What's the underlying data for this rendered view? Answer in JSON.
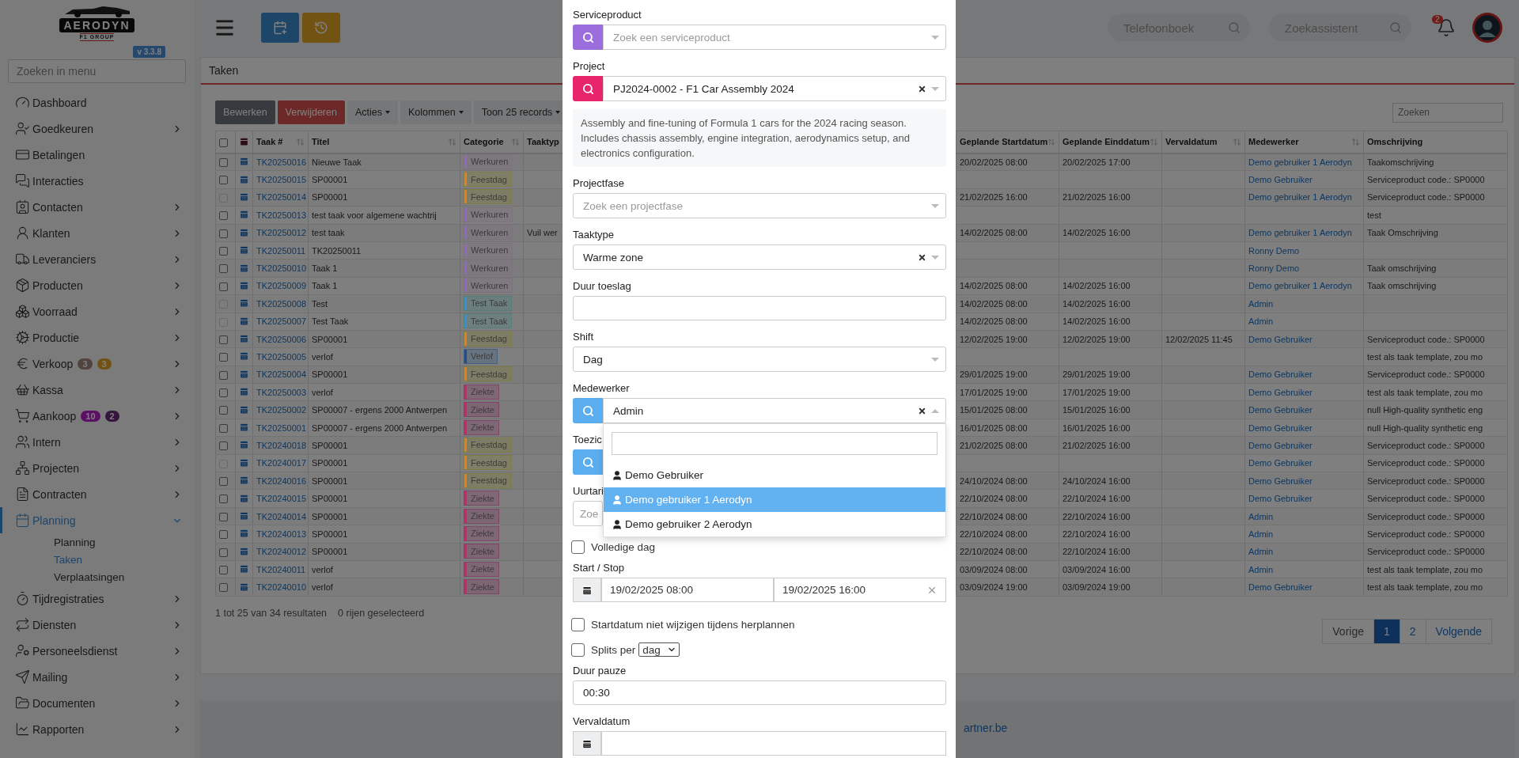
{
  "sidebar": {
    "logo": {
      "wordmark": "AERODYN",
      "subtitle": "F1 GROUP"
    },
    "version": "v 3.3.8",
    "search": {
      "placeholder": "Zoeken in menu"
    },
    "items": [
      {
        "label": "Dashboard",
        "kind": "link",
        "selected": false
      },
      {
        "label": "Goedkeuren",
        "kind": "group",
        "expanded": false,
        "selected": false
      },
      {
        "label": "Betalingen",
        "kind": "link",
        "selected": false
      },
      {
        "label": "Interacties",
        "kind": "link",
        "selected": false
      },
      {
        "label": "Contacten",
        "kind": "group",
        "expanded": false,
        "selected": false
      },
      {
        "label": "Klanten",
        "kind": "group",
        "expanded": false,
        "selected": false
      },
      {
        "label": "Leveranciers",
        "kind": "group",
        "expanded": false,
        "selected": false
      },
      {
        "label": "Producten",
        "kind": "group",
        "expanded": false,
        "selected": false
      },
      {
        "label": "Voorraad",
        "kind": "group",
        "expanded": false,
        "selected": false
      },
      {
        "label": "Productie",
        "kind": "group",
        "expanded": false,
        "selected": false
      },
      {
        "label": "Verkoop",
        "kind": "group",
        "expanded": false,
        "selected": false,
        "badges": [
          {
            "text": "3",
            "color": "#50443f"
          },
          {
            "text": "3",
            "color": "#705213"
          }
        ]
      },
      {
        "label": "Kassa",
        "kind": "group",
        "expanded": false,
        "selected": false
      },
      {
        "label": "Aankoop",
        "kind": "group",
        "expanded": false,
        "selected": false,
        "badges": [
          {
            "text": "10",
            "color": "#5b1064"
          },
          {
            "text": "2",
            "color": "#35153c"
          }
        ]
      },
      {
        "label": "Intern",
        "kind": "group",
        "expanded": false,
        "selected": false
      },
      {
        "label": "Projecten",
        "kind": "group",
        "expanded": false,
        "selected": false
      },
      {
        "label": "Contracten",
        "kind": "group",
        "expanded": false,
        "selected": false
      },
      {
        "label": "Planning",
        "kind": "group",
        "expanded": true,
        "selected": true,
        "children": [
          {
            "label": "Planning",
            "selected": false
          },
          {
            "label": "Taken",
            "selected": true
          },
          {
            "label": "Verplaatsingen",
            "selected": false
          }
        ]
      },
      {
        "label": "Tijdregistraties",
        "kind": "group",
        "expanded": false,
        "selected": false
      },
      {
        "label": "Diensten",
        "kind": "group",
        "expanded": false,
        "selected": false
      },
      {
        "label": "Personeelsdienst",
        "kind": "group",
        "expanded": false,
        "selected": false
      },
      {
        "label": "Mailing",
        "kind": "group",
        "expanded": false,
        "selected": false
      },
      {
        "label": "Documenten",
        "kind": "group",
        "expanded": false,
        "selected": false
      },
      {
        "label": "Rapporten",
        "kind": "group",
        "expanded": false,
        "selected": false
      }
    ]
  },
  "topbar": {
    "phonebook": {
      "placeholder": "Telefoonboek"
    },
    "assistant": {
      "placeholder": "Zoekassistent"
    },
    "notifications": {
      "count": "2"
    }
  },
  "panel": {
    "title": "Taken",
    "toolbar": [
      {
        "label": "Bewerken",
        "kind": "secondary"
      },
      {
        "label": "Verwijderen",
        "kind": "danger"
      },
      {
        "label": "Acties",
        "kind": "dropdown"
      },
      {
        "label": "Kolommen",
        "kind": "dropdown"
      },
      {
        "label": "Toon 25 records",
        "kind": "dropdown"
      }
    ],
    "search": {
      "placeholder": "Zoeken"
    },
    "table": {
      "select_all_checked": false,
      "columns_left": [
        {
          "label": "Taak #",
          "sortable": true
        },
        {
          "label": "Titel",
          "sortable": true
        },
        {
          "label": "Categorie",
          "sortable": true
        },
        {
          "label": "Taaktyp",
          "sortable": false
        }
      ],
      "columns_right": [
        {
          "label": "Geplande Startdatum",
          "sortable": true
        },
        {
          "label": "Geplande Einddatum",
          "sortable": true
        },
        {
          "label": "Vervaldatum",
          "sortable": true
        },
        {
          "label": "Medewerker",
          "sortable": true
        },
        {
          "label": "Omschrijving",
          "sortable": false
        }
      ],
      "rows": [
        {
          "task_no": "TK20250016",
          "title": "Nieuwe Taak",
          "category": {
            "label": "Werkuren",
            "color": "#8e6bbf"
          },
          "start": "20/02/2025 08:00",
          "end": "20/02/2025 17:00",
          "employee": "Demo gebruiker 1 Aerodyn",
          "description": "Taakomschrijving",
          "checked": false,
          "disabled": false
        },
        {
          "task_no": "TK20250015",
          "title": "SP00001",
          "category": {
            "label": "Feestdag",
            "color": "#e67e22"
          },
          "employee": "Demo Gebruiker",
          "description": "Serviceproduct code.: SP0000",
          "checked": false,
          "disabled": false
        },
        {
          "task_no": "TK20250014",
          "title": "SP00001",
          "category": {
            "label": "Feestdag",
            "color": "#e67e22"
          },
          "start": "21/02/2025 16:00",
          "end": "21/02/2025 16:00",
          "employee": "Demo gebruiker 1 Aerodyn",
          "description": "Serviceproduct code.: SP0000",
          "checked": false,
          "disabled": true
        },
        {
          "task_no": "TK20250013",
          "title": "test taak voor algemene wachtrij",
          "category": {
            "label": "Werkuren",
            "color": "#8e6bbf"
          },
          "description": "test",
          "checked": false,
          "disabled": false
        },
        {
          "task_no": "TK20250012",
          "title": "test taak",
          "category": {
            "label": "Werkuren",
            "color": "#8e6bbf"
          },
          "type": "Vuil wer",
          "start": "14/02/2025 08:00",
          "end": "14/02/2025 16:00",
          "employee": "Demo gebruiker 1 Aerodyn",
          "description": "Taak Omschrijving",
          "checked": false,
          "disabled": false
        },
        {
          "task_no": "TK20250011",
          "title": "TK20250011",
          "category": {
            "label": "Werkuren",
            "color": "#8e6bbf"
          },
          "employee": "Ronny Demo",
          "checked": false,
          "disabled": false
        },
        {
          "task_no": "TK20250010",
          "title": "Taak 1",
          "category": {
            "label": "Werkuren",
            "color": "#8e6bbf"
          },
          "employee": "Ronny Demo",
          "description": "Taak omschrijving",
          "checked": false,
          "disabled": false
        },
        {
          "task_no": "TK20250009",
          "title": "Taak 1",
          "category": {
            "label": "Werkuren",
            "color": "#8e6bbf"
          },
          "start": "14/02/2025 08:00",
          "end": "14/02/2025 16:00",
          "employee": "Demo gebruiker 1 Aerodyn",
          "description": "Taak omschrijving",
          "checked": false,
          "disabled": false
        },
        {
          "task_no": "TK20250008",
          "title": "Test",
          "category": {
            "label": "Test Taak",
            "color": "#3b8ed6"
          },
          "start": "14/02/2025 08:00",
          "end": "14/02/2025 16:00",
          "employee": "Admin",
          "checked": false,
          "disabled": true
        },
        {
          "task_no": "TK20250007",
          "title": "Test Taak",
          "category": {
            "label": "Test Taak",
            "color": "#3b8ed6"
          },
          "start": "14/02/2025 08:00",
          "end": "14/02/2025 16:00",
          "employee": "Admin",
          "checked": false,
          "disabled": true
        },
        {
          "task_no": "TK20250006",
          "title": "SP00001",
          "category": {
            "label": "Feestdag",
            "color": "#e67e22"
          },
          "start": "12/02/2025 19:00",
          "end": "12/02/2025 19:00",
          "due": "12/02/2025 11:45",
          "employee": "Demo Gebruiker",
          "description": "Serviceproduct code.: SP0000",
          "checked": false,
          "disabled": false
        },
        {
          "task_no": "TK20250005",
          "title": "verlof",
          "category": {
            "label": "Verlof",
            "color": "#1f4e8c"
          },
          "description": "test als taak template, zou mo",
          "checked": false,
          "disabled": false
        },
        {
          "task_no": "TK20250004",
          "title": "SP00001",
          "category": {
            "label": "Feestdag",
            "color": "#e67e22"
          },
          "start": "29/01/2025 19:00",
          "end": "29/01/2025 19:00",
          "employee": "Demo Gebruiker",
          "description": "Serviceproduct code.: SP0000",
          "checked": false,
          "disabled": false
        },
        {
          "task_no": "TK20250003",
          "title": "verlof",
          "category": {
            "label": "Ziekte",
            "color": "#d6245c"
          },
          "start": "17/01/2025 19:00",
          "end": "17/01/2025 19:00",
          "employee": "Demo Gebruiker",
          "description": "test als taak template, zou mo",
          "checked": false,
          "disabled": false
        },
        {
          "task_no": "TK20250002",
          "title": "SP00007 - ergens 2000 Antwerpen",
          "category": {
            "label": "Ziekte",
            "color": "#d6245c"
          },
          "start": "15/01/2025 08:00",
          "end": "15/01/2025 16:00",
          "employee": "Demo Gebruiker",
          "description": "null High-quality synthetic eng",
          "checked": false,
          "disabled": false
        },
        {
          "task_no": "TK20250001",
          "title": "SP00007 - ergens 2000 Antwerpen",
          "category": {
            "label": "Ziekte",
            "color": "#d6245c"
          },
          "start": "16/01/2025 08:00",
          "end": "16/01/2025 16:00",
          "employee": "Demo Gebruiker",
          "description": "null High-quality synthetic eng",
          "checked": false,
          "disabled": false
        },
        {
          "task_no": "TK20240018",
          "title": "SP00001",
          "category": {
            "label": "Feestdag",
            "color": "#e67e22"
          },
          "start": "21/02/2025 08:00",
          "end": "21/02/2025 16:00",
          "employee": "Demo Gebruiker",
          "description": "Serviceproduct code.: SP0000",
          "checked": false,
          "disabled": false
        },
        {
          "task_no": "TK20240017",
          "title": "SP00001",
          "category": {
            "label": "Feestdag",
            "color": "#e67e22"
          },
          "employee": "Demo Gebruiker",
          "description": "Serviceproduct code.: SP0000",
          "checked": false,
          "disabled": true
        },
        {
          "task_no": "TK20240016",
          "title": "SP00001",
          "category": {
            "label": "Feestdag",
            "color": "#e67e22"
          },
          "start": "24/10/2024 08:00",
          "end": "24/10/2024 16:00",
          "employee": "Demo Gebruiker",
          "description": "Serviceproduct code.: SP0000",
          "checked": false,
          "disabled": false
        },
        {
          "task_no": "TK20240015",
          "title": "SP00001",
          "category": {
            "label": "Ziekte",
            "color": "#d6245c"
          },
          "start": "22/10/2024 08:00",
          "end": "22/10/2024 16:00",
          "employee": "Demo Gebruiker",
          "description": "Serviceproduct code.: SP0000",
          "checked": false,
          "disabled": false
        },
        {
          "task_no": "TK20240014",
          "title": "SP00001",
          "category": {
            "label": "Ziekte",
            "color": "#d6245c"
          },
          "start": "22/10/2024 08:00",
          "end": "22/10/2024 16:00",
          "employee": "Admin",
          "description": "Serviceproduct code.: SP0000",
          "checked": false,
          "disabled": false
        },
        {
          "task_no": "TK20240013",
          "title": "SP00001",
          "category": {
            "label": "Ziekte",
            "color": "#d6245c"
          },
          "start": "22/10/2024 08:00",
          "end": "22/10/2024 16:00",
          "employee": "Admin",
          "description": "Serviceproduct code.: SP0000",
          "checked": false,
          "disabled": false
        },
        {
          "task_no": "TK20240012",
          "title": "SP00001",
          "category": {
            "label": "Ziekte",
            "color": "#d6245c"
          },
          "start": "22/10/2024 08:00",
          "end": "22/10/2024 16:00",
          "employee": "Admin",
          "description": "Serviceproduct code.: SP0000",
          "checked": false,
          "disabled": false
        },
        {
          "task_no": "TK20240011",
          "title": "verlof",
          "category": {
            "label": "Ziekte",
            "color": "#d6245c"
          },
          "start": "03/09/2024 08:00",
          "end": "03/09/2024 16:00",
          "employee": "Admin",
          "description": "test als taak template, zou mo",
          "checked": false,
          "disabled": false
        },
        {
          "task_no": "TK20240010",
          "title": "verlof",
          "category": {
            "label": "Ziekte",
            "color": "#d6245c"
          },
          "start": "03/09/2024 19:00",
          "end": "03/09/2024 19:00",
          "employee": "Demo Gebruiker",
          "description": "test als taak template, zou mo",
          "checked": false,
          "disabled": false
        }
      ]
    },
    "summary": "1 tot 25 van 34 resultaten",
    "selection": "0 rijen geselecteerd",
    "pagination": [
      {
        "label": "Vorige",
        "selected": false
      },
      {
        "label": "1",
        "selected": true
      },
      {
        "label": "2",
        "selected": false
      },
      {
        "label": "Volgende",
        "selected": false
      }
    ]
  },
  "footer": {
    "link": "artner.be"
  },
  "modal": {
    "fields": [
      {
        "kind": "search-select",
        "label": "Serviceproduct",
        "color": "#9c6ddc",
        "placeholder": "Zoek een serviceproduct"
      },
      {
        "kind": "search-select",
        "label": "Project",
        "color": "#e8246a",
        "value": "PJ2024-0002 - F1 Car Assembly 2024",
        "clearable": true
      },
      {
        "kind": "note",
        "text": "Assembly and fine-tuning of Formula 1 cars for the 2024 racing season. Includes chassis assembly, engine integration, aerodynamics setup, and electronics configuration."
      },
      {
        "kind": "select",
        "label": "Projectfase",
        "placeholder": "Zoek een projectfase"
      },
      {
        "kind": "select",
        "label": "Taaktype",
        "value": "Warme zone",
        "clearable": true
      },
      {
        "kind": "text",
        "label": "Duur toeslag"
      },
      {
        "kind": "select",
        "label": "Shift",
        "value": "Dag"
      },
      {
        "kind": "search-select",
        "label": "Medewerker",
        "color": "#5aaef0",
        "value": "Admin",
        "clearable": true,
        "open": true,
        "options": [
          {
            "label": "Demo Gebruiker",
            "selected": false
          },
          {
            "label": "Demo gebruiker 1 Aerodyn",
            "selected": true
          },
          {
            "label": "Demo gebruiker 2 Aerodyn",
            "selected": false
          }
        ]
      },
      {
        "kind": "search-select",
        "label": "Toezic",
        "color": "#5aaef0"
      },
      {
        "kind": "select",
        "label": "Uurtari",
        "placeholder": "Zoe"
      },
      {
        "kind": "checkbox",
        "label": "Volledige dag",
        "checked": false
      },
      {
        "kind": "date-range",
        "label": "Start / Stop",
        "start": "19/02/2025 08:00",
        "end": "19/02/2025 16:00"
      },
      {
        "kind": "checkbox",
        "label": "Startdatum niet wijzigen tijdens herplannen",
        "checked": false
      },
      {
        "kind": "checkbox",
        "label": "Splits per",
        "checked": false,
        "select": "dag"
      },
      {
        "kind": "text",
        "label": "Duur pauze",
        "value": "00:30"
      },
      {
        "kind": "date",
        "label": "Vervaldatum"
      }
    ]
  }
}
